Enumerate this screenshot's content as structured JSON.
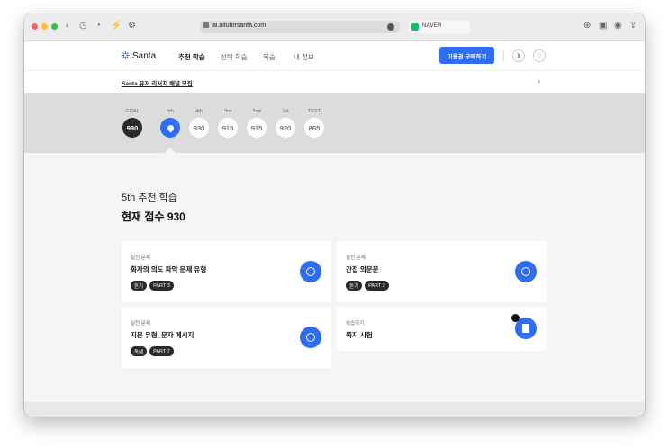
{
  "browser": {
    "url": "ai.aitutorsanta.com",
    "bookmark_label": "NAVER"
  },
  "header": {
    "logo_text": "Santa",
    "nav": [
      "추천 학습",
      "선택 학습",
      "복습",
      "내 정보"
    ],
    "buy_button": "이용권 구매하기"
  },
  "banner": {
    "text": "Santa 유저 리서치 패널 모집",
    "arrow": "›"
  },
  "scores": [
    {
      "label": "GOAL",
      "value": "990"
    },
    {
      "label": "5th",
      "value": ""
    },
    {
      "label": "4th",
      "value": "930"
    },
    {
      "label": "3rd",
      "value": "915"
    },
    {
      "label": "2nd",
      "value": "915"
    },
    {
      "label": "1st",
      "value": "920"
    },
    {
      "label": "TEST",
      "value": "865"
    }
  ],
  "main": {
    "subtitle": "5th 추천 학습",
    "title": "현재 점수 930"
  },
  "cards": [
    {
      "category": "실전 문제",
      "title": "화자의 의도 파악 문제 유형",
      "tags": [
        "듣기",
        "PART 3"
      ]
    },
    {
      "category": "실전 문제",
      "title": "간접 의문문",
      "tags": [
        "듣기",
        "PART 2"
      ]
    },
    {
      "category": "실전 문제",
      "title": "지문 유형_문자 메시지",
      "tags": [
        "독해",
        "PART 7"
      ]
    },
    {
      "category": "복습하기",
      "title": "쪽지 시험",
      "tags": []
    }
  ],
  "colors": {
    "accent": "#2f6df6",
    "dark": "#2a2a2a",
    "strip": "#dcdcdc"
  },
  "icons": [
    "back-icon",
    "forward-icon",
    "history-icon",
    "santa-icon",
    "bolt-icon",
    "settings-icon",
    "lock-icon",
    "download-icon",
    "share-icon",
    "cart-icon",
    "bell-icon",
    "location-pin-icon",
    "search-circle-icon",
    "note-icon"
  ]
}
